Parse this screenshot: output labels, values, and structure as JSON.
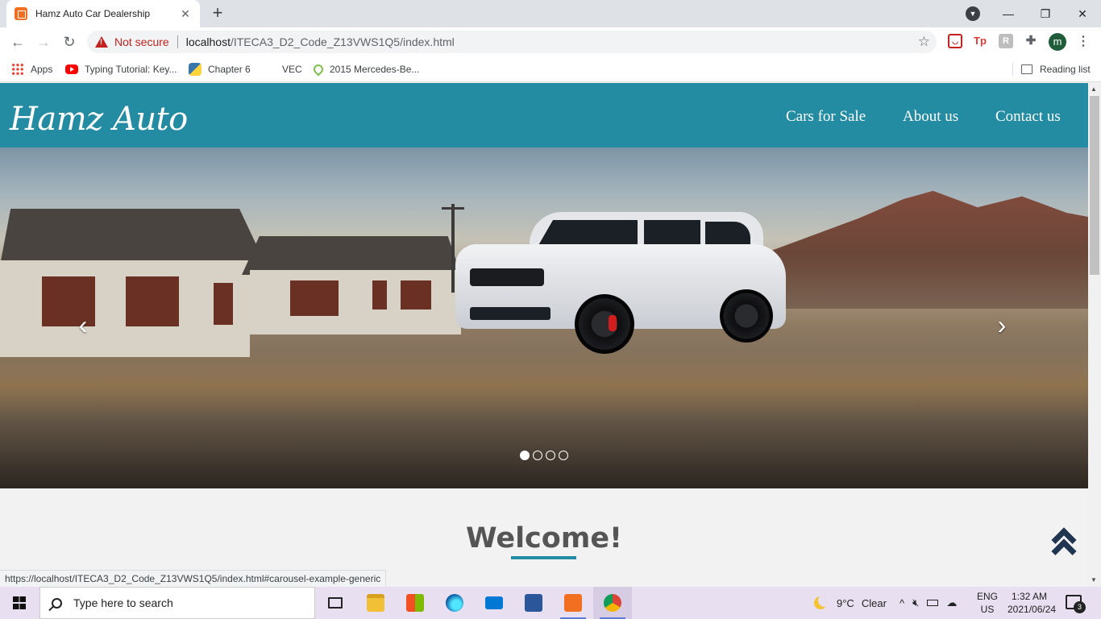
{
  "browser": {
    "tab_title": "Hamz Auto Car Dealership",
    "tab_close": "✕",
    "new_tab": "+",
    "security_label": "Not secure",
    "url_host": "localhost",
    "url_path": "/ITECA3_D2_Code_Z13VWS1Q5/index.html",
    "avatar_letter": "m",
    "bookmarks": [
      {
        "label": "Apps",
        "icon": "apps-grid-icon"
      },
      {
        "label": "Typing Tutorial: Key...",
        "icon": "youtube-icon"
      },
      {
        "label": "Chapter 6",
        "icon": "python-icon"
      },
      {
        "label": "VEC",
        "icon": "blank-page-icon"
      },
      {
        "label": "2015 Mercedes-Be...",
        "icon": "leaf-icon"
      }
    ],
    "reading_list": "Reading list",
    "status_url": "https://localhost/ITECA3_D2_Code_Z13VWS1Q5/index.html#carousel-example-generic"
  },
  "site": {
    "brand": "Hamz Auto",
    "nav": [
      "Cars for Sale",
      "About us",
      "Contact us"
    ],
    "carousel": {
      "slide_count": 4,
      "active_index": 0,
      "prev_glyph": "‹",
      "next_glyph": "›"
    },
    "welcome": "Welcome!",
    "accent_color": "#238ca3"
  },
  "taskbar": {
    "search_placeholder": "Type here to search",
    "weather_temp": "9°C",
    "weather_text": "Clear",
    "lang_line1": "ENG",
    "lang_line2": "US",
    "time": "1:32 AM",
    "date": "2021/06/24",
    "notification_count": "3"
  }
}
